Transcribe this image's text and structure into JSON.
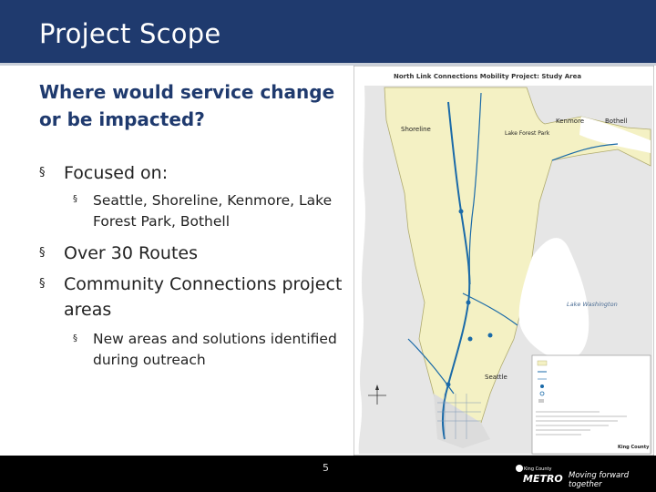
{
  "slide": {
    "title": "Project Scope",
    "subtitle": "Where would service change or be impacted?",
    "bullets": {
      "focused": "Focused on:",
      "focused_sub": "Seattle, Shoreline, Kenmore, Lake Forest Park, Bothell",
      "routes": "Over 30 Routes",
      "community": "Community Connections project areas",
      "community_sub": "New areas and solutions identified during outreach"
    },
    "bullet_glyph": "§"
  },
  "map": {
    "title": "North Link Connections Mobility Project: Study Area",
    "labels": {
      "shoreline": "Shoreline",
      "kenmore": "Kenmore",
      "bothell": "Bothell",
      "lake_forest_park": "Lake Forest Park",
      "lake_washington": "Lake Washington",
      "seattle": "Seattle",
      "king_county": "King County"
    }
  },
  "footer": {
    "page_number": "5",
    "logo_top": "King County",
    "logo_main": "METRO",
    "tagline": "Moving forward together"
  },
  "colors": {
    "title_bar": "#1f3a6e",
    "subtitle": "#1f3a6e",
    "footer": "#000000",
    "map_land": "#e6e6e6",
    "map_study_area": "#f4f1c4",
    "map_water": "#ffffff",
    "map_route": "#1a6aa8"
  }
}
